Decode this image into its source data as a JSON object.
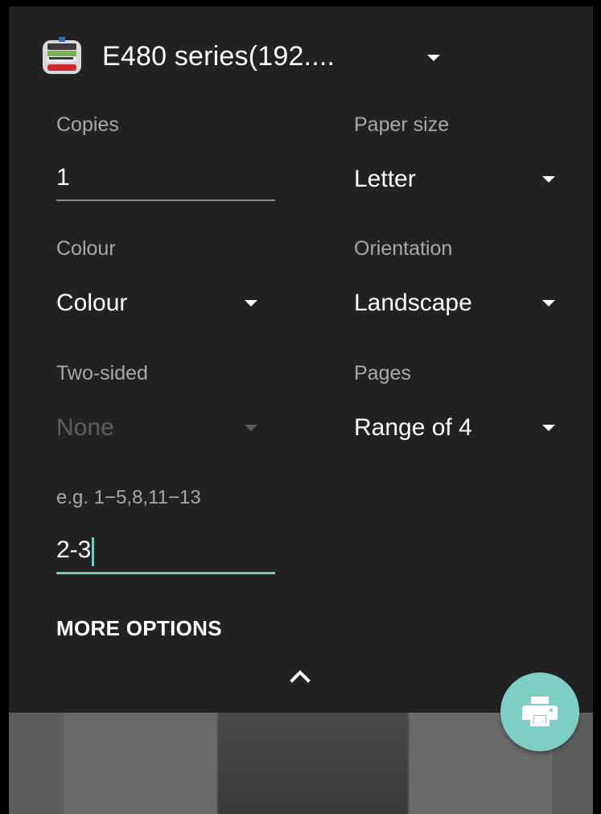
{
  "printer": {
    "name": "E480 series(192....",
    "icon": "printer-app-icon"
  },
  "fields": {
    "copies": {
      "label": "Copies",
      "value": "1"
    },
    "paper_size": {
      "label": "Paper size",
      "value": "Letter"
    },
    "colour": {
      "label": "Colour",
      "value": "Colour"
    },
    "orientation": {
      "label": "Orientation",
      "value": "Landscape"
    },
    "two_sided": {
      "label": "Two-sided",
      "value": "None",
      "disabled": true
    },
    "pages": {
      "label": "Pages",
      "value": "Range of 4"
    },
    "range": {
      "hint": "e.g. 1−5,8,11−13",
      "value": "2-3"
    }
  },
  "more_options": "MORE OPTIONS",
  "colors": {
    "panel_bg": "#222222",
    "accent": "#6ecbc0",
    "fab": "#7dcfc4",
    "label_text": "#a8a8a8",
    "disabled_text": "#5e5e5e"
  },
  "icons": {
    "expand": "chevron-up-icon",
    "print": "print-icon",
    "dropdown": "caret-down-icon"
  }
}
